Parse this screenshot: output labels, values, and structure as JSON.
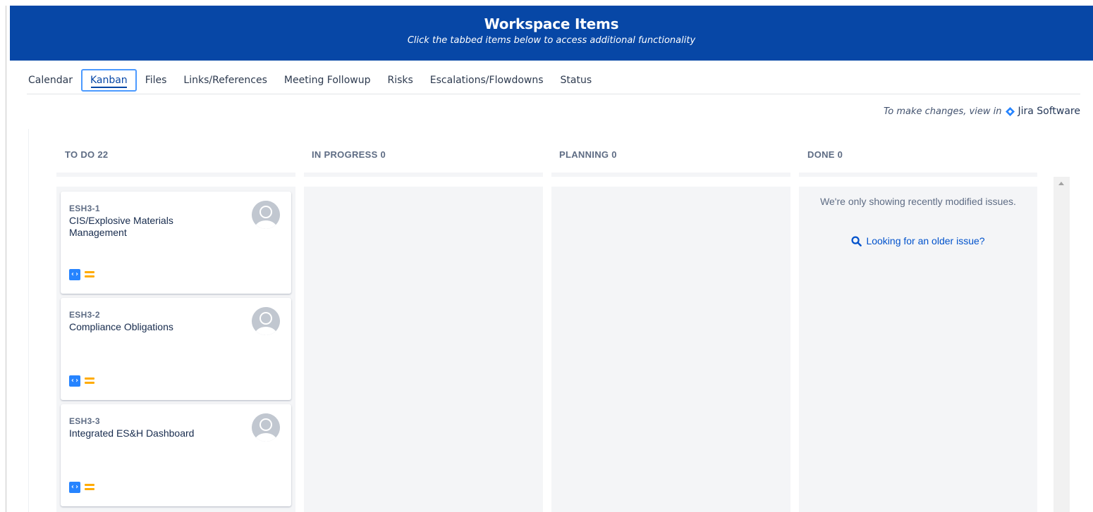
{
  "banner": {
    "title": "Workspace Items",
    "subtitle": "Click the tabbed items below to access additional functionality"
  },
  "tabs": [
    {
      "label": "Calendar",
      "active": false
    },
    {
      "label": "Kanban",
      "active": true
    },
    {
      "label": "Files",
      "active": false
    },
    {
      "label": "Links/References",
      "active": false
    },
    {
      "label": "Meeting Followup",
      "active": false
    },
    {
      "label": "Risks",
      "active": false
    },
    {
      "label": "Escalations/Flowdowns",
      "active": false
    },
    {
      "label": "Status",
      "active": false
    }
  ],
  "jira": {
    "prompt": "To make changes, view in",
    "product": "Jira Software",
    "icon": "jira-diamond-icon",
    "color": "#2684ff"
  },
  "columns": [
    {
      "title": "TO DO 22"
    },
    {
      "title": "IN PROGRESS 0"
    },
    {
      "title": "PLANNING 0"
    },
    {
      "title": "DONE 0"
    }
  ],
  "cards": [
    {
      "key": "ESH3-1",
      "title": "CIS/Explosive Materials Management",
      "type_icon": "task-code-icon",
      "priority_icon": "medium-priority-icon"
    },
    {
      "key": "ESH3-2",
      "title": "Compliance Obligations",
      "type_icon": "task-code-icon",
      "priority_icon": "medium-priority-icon"
    },
    {
      "key": "ESH3-3",
      "title": "Integrated ES&H Dashboard",
      "type_icon": "task-code-icon",
      "priority_icon": "medium-priority-icon"
    }
  ],
  "done": {
    "empty_message": "We're only showing recently modified issues.",
    "older_link": "Looking for an older issue?"
  },
  "colors": {
    "banner": "#0747a6",
    "link": "#0052cc",
    "priority_medium": "#ffab00",
    "issue_type": "#2684ff"
  }
}
